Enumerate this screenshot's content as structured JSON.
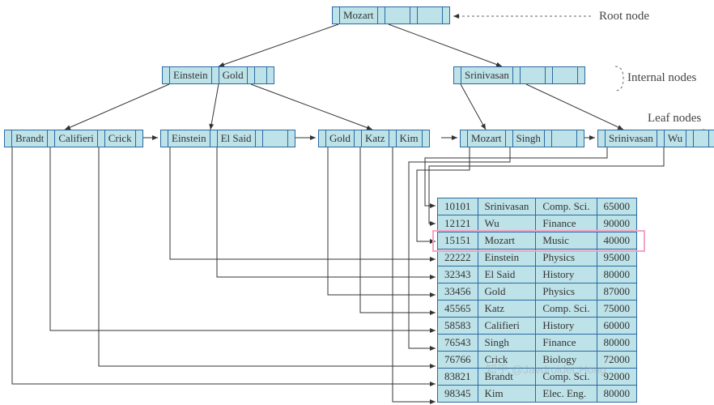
{
  "labels": {
    "root": "Root node",
    "internal": "Internal nodes",
    "leaf": "Leaf nodes"
  },
  "tree": {
    "root": {
      "keys": [
        "Mozart"
      ]
    },
    "internal": [
      {
        "keys": [
          "Einstein",
          "Gold"
        ]
      },
      {
        "keys": [
          "Srinivasan"
        ]
      }
    ],
    "leaves": [
      {
        "keys": [
          "Brandt",
          "Califieri",
          "Crick"
        ]
      },
      {
        "keys": [
          "Einstein",
          "El Said"
        ]
      },
      {
        "keys": [
          "Gold",
          "Katz",
          "Kim"
        ]
      },
      {
        "keys": [
          "Mozart",
          "Singh"
        ]
      },
      {
        "keys": [
          "Srinivasan",
          "Wu"
        ]
      }
    ]
  },
  "table": {
    "rows": [
      {
        "id": "10101",
        "name": "Srinivasan",
        "dept": "Comp. Sci.",
        "salary": "65000"
      },
      {
        "id": "12121",
        "name": "Wu",
        "dept": "Finance",
        "salary": "90000"
      },
      {
        "id": "15151",
        "name": "Mozart",
        "dept": "Music",
        "salary": "40000"
      },
      {
        "id": "22222",
        "name": "Einstein",
        "dept": "Physics",
        "salary": "95000"
      },
      {
        "id": "32343",
        "name": "El Said",
        "dept": "History",
        "salary": "80000"
      },
      {
        "id": "33456",
        "name": "Gold",
        "dept": "Physics",
        "salary": "87000"
      },
      {
        "id": "45565",
        "name": "Katz",
        "dept": "Comp. Sci.",
        "salary": "75000"
      },
      {
        "id": "58583",
        "name": "Califieri",
        "dept": "History",
        "salary": "60000"
      },
      {
        "id": "76543",
        "name": "Singh",
        "dept": "Finance",
        "salary": "80000"
      },
      {
        "id": "76766",
        "name": "Crick",
        "dept": "Biology",
        "salary": "72000"
      },
      {
        "id": "83821",
        "name": "Brandt",
        "dept": "Comp. Sci.",
        "salary": "92000"
      },
      {
        "id": "98345",
        "name": "Kim",
        "dept": "Elec. Eng.",
        "salary": "80000"
      }
    ],
    "highlight_row_index": 2
  },
  "watermark": "知乎 @Javdroider Hong"
}
